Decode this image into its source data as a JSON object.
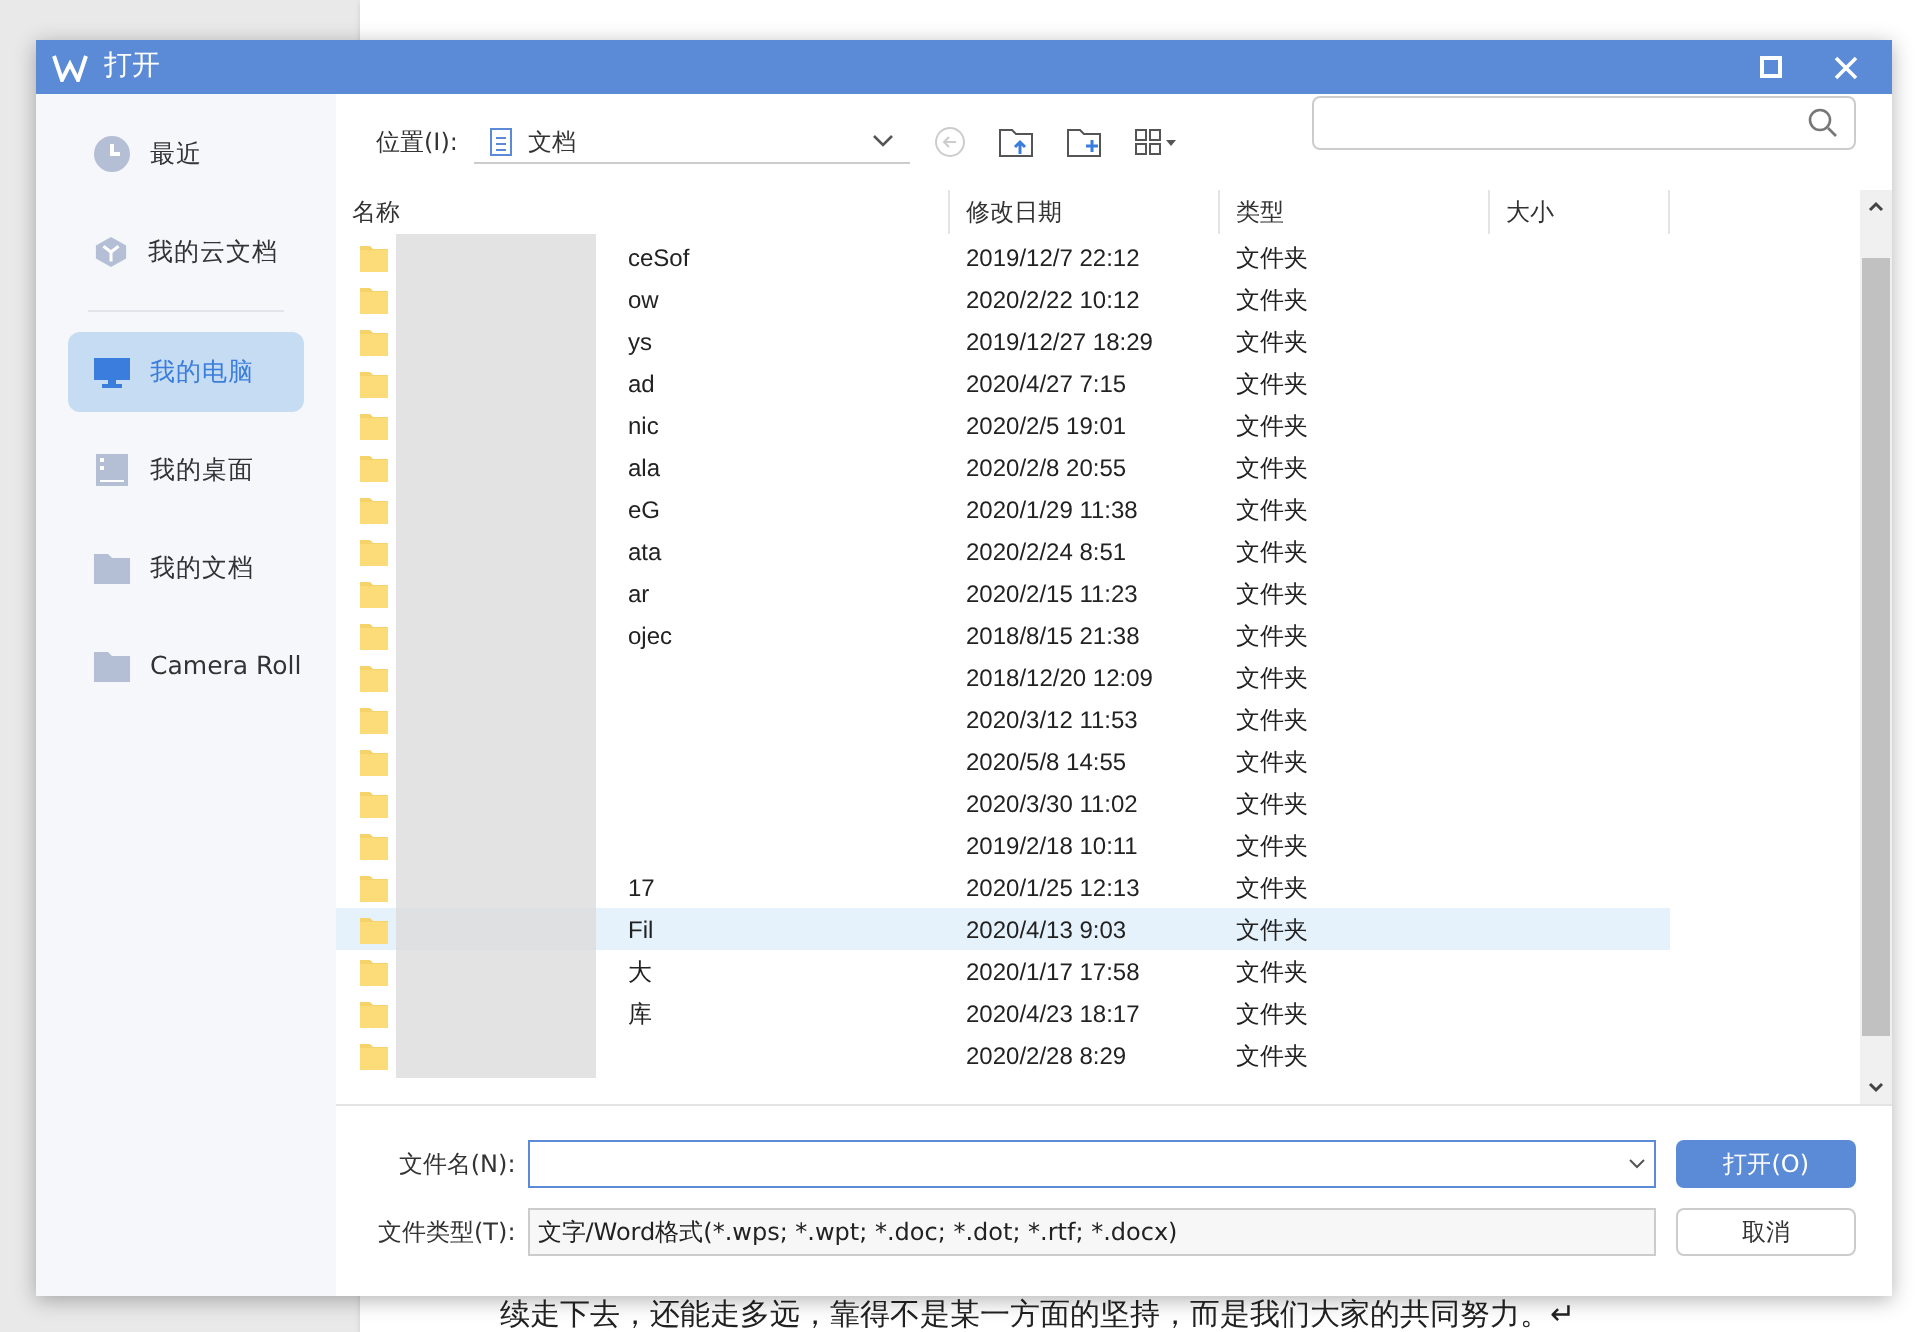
{
  "window": {
    "title": "打开"
  },
  "sidebar": {
    "items": [
      {
        "label": "最近",
        "kind": "clock",
        "selected": false
      },
      {
        "label": "我的云文档",
        "kind": "cloud",
        "selected": false
      },
      {
        "label": "我的电脑",
        "kind": "computer",
        "selected": true
      },
      {
        "label": "我的桌面",
        "kind": "desktop",
        "selected": false
      },
      {
        "label": "我的文档",
        "kind": "folder",
        "selected": false
      },
      {
        "label": "Camera Roll",
        "kind": "folder",
        "selected": false
      }
    ]
  },
  "location": {
    "label": "位置(I):",
    "value": "文档"
  },
  "table": {
    "columns": [
      "名称",
      "修改日期",
      "类型",
      "大小"
    ],
    "rows": [
      {
        "name": "ceSof",
        "date": "2019/12/7 22:12",
        "type": "文件夹",
        "selected": false
      },
      {
        "name": "ow",
        "date": "2020/2/22 10:12",
        "type": "文件夹",
        "selected": false
      },
      {
        "name": "ys",
        "date": "2019/12/27 18:29",
        "type": "文件夹",
        "selected": false
      },
      {
        "name": "ad",
        "date": "2020/4/27 7:15",
        "type": "文件夹",
        "selected": false
      },
      {
        "name": "nic",
        "date": "2020/2/5 19:01",
        "type": "文件夹",
        "selected": false
      },
      {
        "name": "ala",
        "date": "2020/2/8 20:55",
        "type": "文件夹",
        "selected": false
      },
      {
        "name": "eG",
        "date": "2020/1/29 11:38",
        "type": "文件夹",
        "selected": false
      },
      {
        "name": "ata",
        "date": "2020/2/24 8:51",
        "type": "文件夹",
        "selected": false
      },
      {
        "name": "ar",
        "date": "2020/2/15 11:23",
        "type": "文件夹",
        "selected": false
      },
      {
        "name": "ojec",
        "date": "2018/8/15 21:38",
        "type": "文件夹",
        "selected": false
      },
      {
        "date": "2018/12/20 12:09",
        "type": "文件夹",
        "selected": false
      },
      {
        "date": "2020/3/12 11:53",
        "type": "文件夹",
        "selected": false
      },
      {
        "date": "2020/5/8 14:55",
        "type": "文件夹",
        "selected": false
      },
      {
        "date": "2020/3/30 11:02",
        "type": "文件夹",
        "selected": false
      },
      {
        "date": "2019/2/18 10:11",
        "type": "文件夹",
        "selected": false
      },
      {
        "name": "17",
        "date": "2020/1/25 12:13",
        "type": "文件夹",
        "selected": false
      },
      {
        "name": "Fil",
        "date": "2020/4/13 9:03",
        "type": "文件夹",
        "selected": true
      },
      {
        "name": "大",
        "date": "2020/1/17 17:58",
        "type": "文件夹",
        "selected": false
      },
      {
        "name": "库",
        "date": "2020/4/23 18:17",
        "type": "文件夹",
        "selected": false
      },
      {
        "date": "2020/2/28 8:29",
        "type": "文件夹",
        "selected": false
      }
    ]
  },
  "filename": {
    "label": "文件名(N):"
  },
  "filetype": {
    "label": "文件类型(T):",
    "value": "文字/Word格式(*.wps; *.wpt; *.doc; *.dot; *.rtf; *.docx)"
  },
  "buttons": {
    "open": "打开(O)",
    "cancel": "取消"
  },
  "document": {
    "line": "续走下去，还能走多远，靠得不是某一方面的坚持，而是我们大家的共同努力。↵"
  }
}
